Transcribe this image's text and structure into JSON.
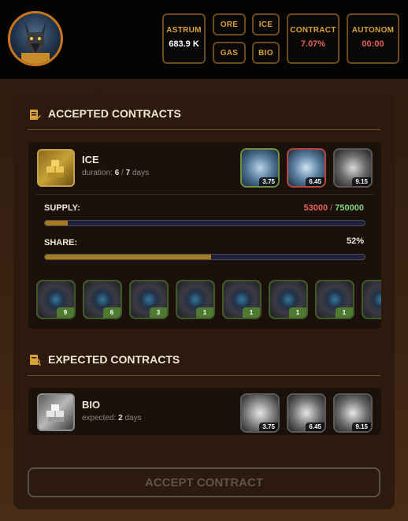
{
  "stats": {
    "astrum": {
      "label": "ASTRUM",
      "value": "683.9 K"
    },
    "ore": {
      "label": "ORE"
    },
    "gas": {
      "label": "GAS"
    },
    "ice": {
      "label": "ICE"
    },
    "bio": {
      "label": "BIO"
    },
    "contract": {
      "label": "CONTRACT",
      "value": "7.07%"
    },
    "autonom": {
      "label": "AUTONOM",
      "value": "00:00"
    }
  },
  "accepted": {
    "title": "ACCEPTED CONTRACTS",
    "resource": "ICE",
    "duration_label": "duration:",
    "duration_current": "6",
    "duration_sep": "/",
    "duration_total": "7",
    "duration_unit": "days",
    "thumbs": [
      "3.75",
      "6.45",
      "9.15"
    ],
    "supply_label": "SUPPLY:",
    "supply_current": "53000",
    "supply_sep": "/",
    "supply_total": "750000",
    "supply_fraction": 0.0707,
    "share_label": "SHARE:",
    "share_value": "52%",
    "share_fraction": 0.52,
    "modules": [
      "9",
      "6",
      "3",
      "1",
      "1",
      "1",
      "1"
    ]
  },
  "expected": {
    "title": "EXPECTED CONTRACTS",
    "resource": "BIO",
    "expected_label": "expected:",
    "expected_value": "2",
    "expected_unit": "days",
    "thumbs": [
      "3.75",
      "6.45",
      "9.15"
    ]
  },
  "accept_button": "ACCEPT CONTRACT",
  "colors": {
    "accent": "#d8a23a",
    "red": "#e8605a",
    "green": "#7fd17a",
    "progress": "#a57c19"
  }
}
